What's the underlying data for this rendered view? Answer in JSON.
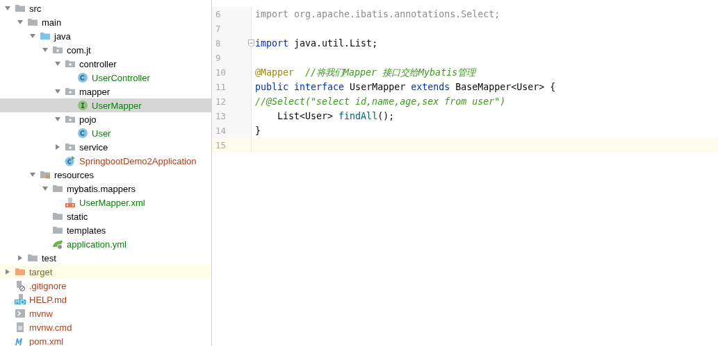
{
  "project_tree": [
    {
      "label": "src",
      "kind": "folder",
      "expanded": true,
      "selected": false,
      "excluded": false,
      "children": [
        {
          "label": "main",
          "kind": "folder",
          "expanded": true,
          "selected": false,
          "excluded": false,
          "children": [
            {
              "label": "java",
              "kind": "source-folder",
              "expanded": true,
              "selected": false,
              "excluded": false,
              "children": [
                {
                  "label": "com.jt",
                  "kind": "package",
                  "expanded": true,
                  "selected": false,
                  "excluded": false,
                  "children": [
                    {
                      "label": "controller",
                      "kind": "package",
                      "expanded": true,
                      "selected": false,
                      "excluded": false,
                      "children": [
                        {
                          "label": "UserController",
                          "kind": "class",
                          "color": "#0a7e07",
                          "selected": false,
                          "excluded": false
                        }
                      ]
                    },
                    {
                      "label": "mapper",
                      "kind": "package",
                      "expanded": true,
                      "selected": false,
                      "excluded": false,
                      "children": [
                        {
                          "label": "UserMapper",
                          "kind": "interface",
                          "color": "#0a7e07",
                          "selected": true,
                          "excluded": false
                        }
                      ]
                    },
                    {
                      "label": "pojo",
                      "kind": "package",
                      "expanded": true,
                      "selected": false,
                      "excluded": false,
                      "children": [
                        {
                          "label": "User",
                          "kind": "class",
                          "color": "#0a7e07",
                          "selected": false,
                          "excluded": false
                        }
                      ]
                    },
                    {
                      "label": "service",
                      "kind": "package",
                      "expanded": false,
                      "selected": false,
                      "excluded": false
                    },
                    {
                      "label": "SpringbootDemo2Application",
                      "kind": "spring-class",
                      "color": "#a8431e",
                      "selected": false,
                      "excluded": false
                    }
                  ]
                }
              ]
            },
            {
              "label": "resources",
              "kind": "resources-folder",
              "expanded": true,
              "selected": false,
              "excluded": false,
              "children": [
                {
                  "label": "mybatis.mappers",
                  "kind": "folder",
                  "expanded": true,
                  "selected": false,
                  "excluded": false,
                  "children": [
                    {
                      "label": "UserMapper.xml",
                      "kind": "xml-file",
                      "color": "#0a7e07",
                      "selected": false,
                      "excluded": false
                    }
                  ]
                },
                {
                  "label": "static",
                  "kind": "folder",
                  "selected": false,
                  "excluded": false
                },
                {
                  "label": "templates",
                  "kind": "folder",
                  "selected": false,
                  "excluded": false
                },
                {
                  "label": "application.yml",
                  "kind": "spring-config",
                  "color": "#0a7e07",
                  "selected": false,
                  "excluded": false
                }
              ]
            }
          ]
        },
        {
          "label": "test",
          "kind": "folder",
          "expanded": false,
          "selected": false,
          "excluded": false
        }
      ]
    },
    {
      "label": "target",
      "kind": "excluded-folder",
      "color": "#7a6a2a",
      "expanded": false,
      "selected": false,
      "excluded": true
    },
    {
      "label": ".gitignore",
      "kind": "ignore-file",
      "color": "#a8431e",
      "selected": false,
      "excluded": false
    },
    {
      "label": "HELP.md",
      "kind": "markdown-file",
      "color": "#a8431e",
      "selected": false,
      "excluded": false
    },
    {
      "label": "mvnw",
      "kind": "script-file",
      "color": "#a8431e",
      "selected": false,
      "excluded": false
    },
    {
      "label": "mvnw.cmd",
      "kind": "text-file",
      "color": "#a8431e",
      "selected": false,
      "excluded": false
    },
    {
      "label": "pom.xml",
      "kind": "maven-file",
      "color": "#a8431e",
      "selected": false,
      "excluded": false
    }
  ],
  "editor": {
    "lines": [
      {
        "number": "6",
        "current": false,
        "fold": false,
        "tokens": [
          {
            "text": "import org.apache.ibatis.annotations.Select;",
            "kind": "unused"
          }
        ]
      },
      {
        "number": "7",
        "current": false,
        "fold": false
      },
      {
        "number": "8",
        "current": false,
        "fold": true,
        "tokens": [
          {
            "text": "import",
            "kind": "keyword"
          },
          {
            "text": " java.util.List;",
            "kind": "plain"
          }
        ]
      },
      {
        "number": "9",
        "current": false,
        "fold": false
      },
      {
        "number": "10",
        "current": false,
        "fold": false,
        "tokens": [
          {
            "text": "@Mapper",
            "kind": "annotation"
          },
          {
            "text": "  //将我们Mapper 接口交给Mybatis管理",
            "kind": "comment"
          }
        ]
      },
      {
        "number": "11",
        "current": false,
        "fold": false,
        "tokens": [
          {
            "text": "public ",
            "kind": "keyword"
          },
          {
            "text": "interface",
            "kind": "keyword"
          },
          {
            "text": " UserMapper ",
            "kind": "plain"
          },
          {
            "text": "extends",
            "kind": "keyword"
          },
          {
            "text": " BaseMapper<User> {",
            "kind": "plain"
          }
        ]
      },
      {
        "number": "12",
        "current": false,
        "fold": false,
        "tokens": [
          {
            "text": "//@Select(\"select id,name,age,sex from user\")",
            "kind": "comment"
          }
        ]
      },
      {
        "number": "13",
        "current": false,
        "fold": false,
        "tokens": [
          {
            "text": "    List<User> ",
            "kind": "plain"
          },
          {
            "text": "findAll",
            "kind": "method"
          },
          {
            "text": "();",
            "kind": "plain"
          }
        ]
      },
      {
        "number": "14",
        "current": false,
        "fold": false,
        "tokens": [
          {
            "text": "}",
            "kind": "plain"
          }
        ]
      },
      {
        "number": "15",
        "current": true,
        "fold": false
      }
    ]
  }
}
